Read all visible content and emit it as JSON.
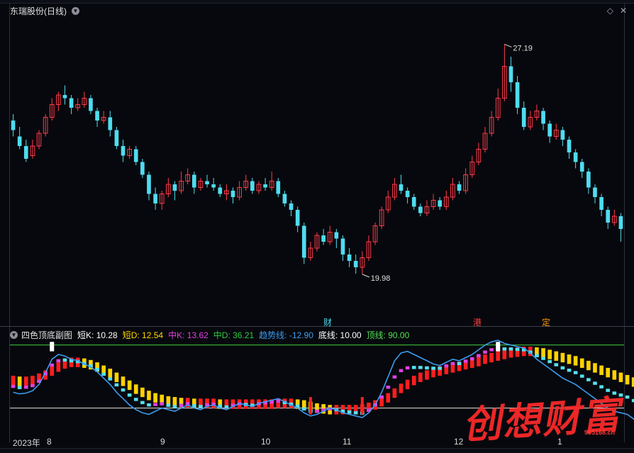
{
  "main": {
    "title": "东瑞股份(日线)",
    "high_label": "27.19",
    "low_label": "19.98",
    "events": [
      {
        "label": "财",
        "color": "#4fd8f0"
      },
      {
        "label": "港",
        "color": "#ff4040"
      },
      {
        "label": "定",
        "color": "#ff9a00"
      }
    ],
    "icons": [
      "collapse-icon",
      "diamond-icon",
      "close-icon"
    ]
  },
  "sub": {
    "title": "四色顶底副图",
    "items": [
      {
        "label": "短K: 10.28",
        "color": "#ffffff"
      },
      {
        "label": "短D: 12.54",
        "color": "#ffd700"
      },
      {
        "label": "中K: 13.62",
        "color": "#e040e0"
      },
      {
        "label": "中D: 36.21",
        "color": "#2ecc40"
      },
      {
        "label": "趋势线: -12.90",
        "color": "#3a9cf0"
      },
      {
        "label": "底线: 10.00",
        "color": "#ffffff"
      },
      {
        "label": "顶线: 90.00",
        "color": "#52e052"
      }
    ]
  },
  "axis": {
    "labels": [
      "2023年",
      "8",
      "9",
      "10",
      "11",
      "12",
      "1"
    ]
  },
  "watermark": {
    "text": "创想财富",
    "url": "995168.cn"
  },
  "colors": {
    "up": "#ff3b4a",
    "down": "#4fdcf0",
    "background": "#07080d",
    "trend": "#3a9cf0"
  },
  "chart_data": {
    "type": "candlestick",
    "y_range": [
      19.0,
      28.0
    ],
    "sub_range": [
      -20,
      105
    ],
    "top_line": 90,
    "bottom_line": 10,
    "candles": [
      [
        24.8,
        24.5,
        25.0,
        24.3
      ],
      [
        24.3,
        24.0,
        24.6,
        23.9
      ],
      [
        24.0,
        23.6,
        24.2,
        23.5
      ],
      [
        23.7,
        24.0,
        24.2,
        23.6
      ],
      [
        24.0,
        24.4,
        24.5,
        23.9
      ],
      [
        24.4,
        24.9,
        25.0,
        24.3
      ],
      [
        24.9,
        25.3,
        25.5,
        24.8
      ],
      [
        25.3,
        25.6,
        25.7,
        25.1
      ],
      [
        25.6,
        25.5,
        25.9,
        25.3
      ],
      [
        25.5,
        25.2,
        25.6,
        25.0
      ],
      [
        25.2,
        25.3,
        25.5,
        25.1
      ],
      [
        25.3,
        25.5,
        25.7,
        25.2
      ],
      [
        25.5,
        25.1,
        25.6,
        25.0
      ],
      [
        25.1,
        24.8,
        25.2,
        24.6
      ],
      [
        24.8,
        24.9,
        25.1,
        24.7
      ],
      [
        24.9,
        24.5,
        25.1,
        24.3
      ],
      [
        24.5,
        24.0,
        24.6,
        23.9
      ],
      [
        24.0,
        23.7,
        24.2,
        23.5
      ],
      [
        23.7,
        23.9,
        24.0,
        23.6
      ],
      [
        23.9,
        23.5,
        24.0,
        23.4
      ],
      [
        23.5,
        23.1,
        23.6,
        23.0
      ],
      [
        23.1,
        22.5,
        23.2,
        22.3
      ],
      [
        22.5,
        22.2,
        22.7,
        22.0
      ],
      [
        22.2,
        22.5,
        22.6,
        22.0
      ],
      [
        22.5,
        22.8,
        23.0,
        22.4
      ],
      [
        22.8,
        22.6,
        22.9,
        22.3
      ],
      [
        22.6,
        22.9,
        23.2,
        22.5
      ],
      [
        22.9,
        23.1,
        23.3,
        22.8
      ],
      [
        23.1,
        22.7,
        23.2,
        22.5
      ],
      [
        22.7,
        22.9,
        23.0,
        22.6
      ],
      [
        22.9,
        22.8,
        23.1,
        22.7
      ],
      [
        22.8,
        22.7,
        23.0,
        22.6
      ],
      [
        22.7,
        22.5,
        22.8,
        22.4
      ],
      [
        22.5,
        22.6,
        22.8,
        22.3
      ],
      [
        22.6,
        22.4,
        22.7,
        22.2
      ],
      [
        22.4,
        22.7,
        22.9,
        22.3
      ],
      [
        22.7,
        22.9,
        23.1,
        22.6
      ],
      [
        22.9,
        22.6,
        23.0,
        22.5
      ],
      [
        22.6,
        22.8,
        22.9,
        22.5
      ],
      [
        22.8,
        22.7,
        23.0,
        22.6
      ],
      [
        22.7,
        22.9,
        23.2,
        22.6
      ],
      [
        22.9,
        22.5,
        23.0,
        22.4
      ],
      [
        22.5,
        22.2,
        22.6,
        22.1
      ],
      [
        22.2,
        22.0,
        22.3,
        21.8
      ],
      [
        22.0,
        21.5,
        22.1,
        21.3
      ],
      [
        21.5,
        20.5,
        21.6,
        20.3
      ],
      [
        20.5,
        20.8,
        21.0,
        20.4
      ],
      [
        20.8,
        21.2,
        21.3,
        20.7
      ],
      [
        21.2,
        21.0,
        21.4,
        20.9
      ],
      [
        21.0,
        21.3,
        21.5,
        20.9
      ],
      [
        21.3,
        21.1,
        21.4,
        20.8
      ],
      [
        21.1,
        20.6,
        21.2,
        20.4
      ],
      [
        20.6,
        20.4,
        20.8,
        20.2
      ],
      [
        20.4,
        20.2,
        20.6,
        20.0
      ],
      [
        20.2,
        20.5,
        20.7,
        19.98
      ],
      [
        20.5,
        21.0,
        21.2,
        20.4
      ],
      [
        21.0,
        21.5,
        21.6,
        20.9
      ],
      [
        21.5,
        22.0,
        22.1,
        21.4
      ],
      [
        22.0,
        22.4,
        22.6,
        21.9
      ],
      [
        22.4,
        22.8,
        23.0,
        22.3
      ],
      [
        22.8,
        22.6,
        23.1,
        22.5
      ],
      [
        22.6,
        22.4,
        22.7,
        22.2
      ],
      [
        22.4,
        22.1,
        22.5,
        22.0
      ],
      [
        22.1,
        21.9,
        22.2,
        21.8
      ],
      [
        21.9,
        22.1,
        22.3,
        21.8
      ],
      [
        22.1,
        22.3,
        22.5,
        22.0
      ],
      [
        22.3,
        22.1,
        22.4,
        22.0
      ],
      [
        22.1,
        22.4,
        22.6,
        22.0
      ],
      [
        22.4,
        22.8,
        23.0,
        22.3
      ],
      [
        22.8,
        22.6,
        22.9,
        22.5
      ],
      [
        22.6,
        23.1,
        23.3,
        22.5
      ],
      [
        23.1,
        23.5,
        23.7,
        23.0
      ],
      [
        23.5,
        23.9,
        24.1,
        23.4
      ],
      [
        23.9,
        24.4,
        24.6,
        23.8
      ],
      [
        24.4,
        24.9,
        25.1,
        24.3
      ],
      [
        24.9,
        25.5,
        25.8,
        24.8
      ],
      [
        25.5,
        26.5,
        27.19,
        25.4
      ],
      [
        26.5,
        26.0,
        26.8,
        25.7
      ],
      [
        26.0,
        25.2,
        26.2,
        25.0
      ],
      [
        25.2,
        24.6,
        25.4,
        24.5
      ],
      [
        24.6,
        24.9,
        25.1,
        24.5
      ],
      [
        24.9,
        25.1,
        25.3,
        24.8
      ],
      [
        25.1,
        24.7,
        25.2,
        24.5
      ],
      [
        24.7,
        24.3,
        24.8,
        24.1
      ],
      [
        24.3,
        24.5,
        24.7,
        24.2
      ],
      [
        24.5,
        24.2,
        24.6,
        24.0
      ],
      [
        24.2,
        23.8,
        24.3,
        23.6
      ],
      [
        23.8,
        23.5,
        23.9,
        23.3
      ],
      [
        23.5,
        23.2,
        23.6,
        23.0
      ],
      [
        23.2,
        22.7,
        23.3,
        22.5
      ],
      [
        22.7,
        22.4,
        22.8,
        22.2
      ],
      [
        22.4,
        22.0,
        22.5,
        21.8
      ],
      [
        22.0,
        21.6,
        22.1,
        21.4
      ],
      [
        21.6,
        21.8,
        22.0,
        21.5
      ],
      [
        21.8,
        21.4,
        21.9,
        21.0
      ]
    ],
    "trend": [
      30,
      28,
      29,
      32,
      40,
      55,
      72,
      78,
      76,
      72,
      70,
      66,
      62,
      56,
      48,
      40,
      30,
      22,
      14,
      8,
      4,
      2,
      6,
      10,
      8,
      6,
      10,
      14,
      10,
      8,
      12,
      14,
      10,
      8,
      12,
      16,
      14,
      12,
      16,
      18,
      20,
      22,
      18,
      14,
      10,
      4,
      0,
      2,
      6,
      10,
      8,
      4,
      2,
      0,
      -2,
      4,
      14,
      30,
      50,
      70,
      80,
      82,
      78,
      74,
      70,
      66,
      64,
      68,
      72,
      70,
      74,
      78,
      84,
      90,
      94,
      96,
      92,
      90,
      88,
      86,
      80,
      72,
      66,
      60,
      54,
      48,
      44,
      40,
      34,
      28,
      22,
      16,
      10,
      6,
      4,
      2,
      -4,
      -8
    ],
    "signal": [
      45,
      44,
      44,
      45,
      48,
      52,
      57,
      62,
      66,
      68,
      68,
      67,
      65,
      62,
      58,
      54,
      49,
      44,
      39,
      34,
      30,
      26,
      23,
      21,
      19,
      18,
      17,
      17,
      16,
      16,
      16,
      16,
      15,
      15,
      15,
      15,
      15,
      15,
      15,
      15,
      15,
      16,
      16,
      16,
      15,
      14,
      12,
      10,
      9,
      8,
      8,
      8,
      8,
      8,
      9,
      11,
      14,
      18,
      23,
      29,
      35,
      40,
      45,
      49,
      52,
      55,
      57,
      59,
      61,
      63,
      65,
      67,
      69,
      72,
      74,
      76,
      78,
      80,
      81,
      82,
      82,
      81,
      80,
      78,
      76,
      74,
      72,
      70,
      67,
      64,
      61,
      58,
      55,
      52,
      49,
      46,
      43,
      40
    ]
  }
}
